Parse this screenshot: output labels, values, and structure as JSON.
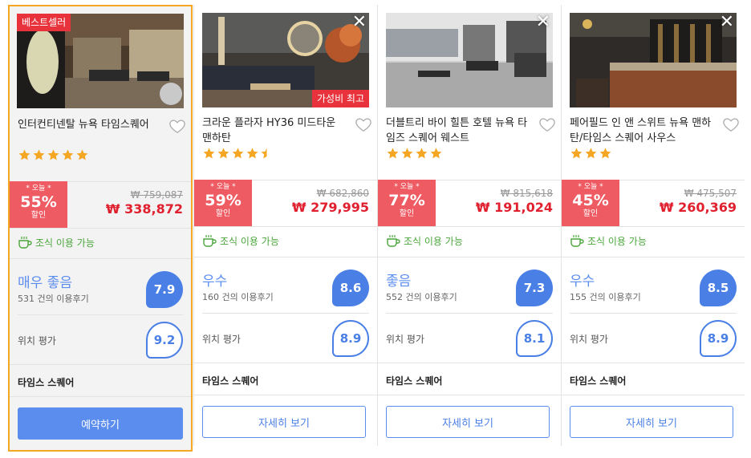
{
  "colors": {
    "accent_blue": "#5b8def",
    "deal_red": "#ef5b62",
    "price_red": "#e0202e",
    "star_orange": "#f5a623",
    "selected_border": "#f5a623",
    "breakfast_green": "#4aa63b"
  },
  "cards": [
    {
      "badge": "베스트셀러",
      "name": "인터컨티넨탈 뉴욕 타임스퀘어",
      "stars": 5,
      "deal_today": "* 오늘 *",
      "deal_pct": "55%",
      "deal_off": "할인",
      "original_price": "₩ 759,087",
      "final_price": "₩ 338,872",
      "breakfast": "조식 이용 가능",
      "rating_word": "매우 좋음",
      "review_count": "531 건의 이용후기",
      "score": "7.9",
      "location_label": "위치 평가",
      "location_score": "9.2",
      "area": "타임스 스퀘어",
      "button": "예약하기"
    },
    {
      "badge": "가성비 최고",
      "name": "크라운 플라자 HY36 미드타운 맨하탄",
      "stars": 4.5,
      "deal_today": "* 오늘 *",
      "deal_pct": "59%",
      "deal_off": "할인",
      "original_price": "₩ 682,860",
      "final_price": "₩ 279,995",
      "breakfast": "조식 이용 가능",
      "rating_word": "우수",
      "review_count": "160 건의 이용후기",
      "score": "8.6",
      "location_label": "위치 평가",
      "location_score": "8.9",
      "area": "타임스 스퀘어",
      "button": "자세히 보기"
    },
    {
      "name": "더블트리 바이 힐튼 호텔 뉴욕 타임즈 스퀘어 웨스트",
      "stars": 4,
      "deal_today": "* 오늘 *",
      "deal_pct": "77%",
      "deal_off": "할인",
      "original_price": "₩ 815,618",
      "final_price": "₩ 191,024",
      "breakfast": "조식 이용 가능",
      "rating_word": "좋음",
      "review_count": "552 건의 이용후기",
      "score": "7.3",
      "location_label": "위치 평가",
      "location_score": "8.1",
      "area": "타임스 스퀘어",
      "button": "자세히 보기"
    },
    {
      "name": "페어필드 인 앤 스위트 뉴욕 맨하탄/타임스 스퀘어 사우스",
      "stars": 3,
      "deal_today": "* 오늘 *",
      "deal_pct": "45%",
      "deal_off": "할인",
      "original_price": "₩ 475,507",
      "final_price": "₩ 260,369",
      "breakfast": "조식 이용 가능",
      "rating_word": "우수",
      "review_count": "155 건의 이용후기",
      "score": "8.5",
      "location_label": "위치 평가",
      "location_score": "8.9",
      "area": "타임스 스퀘어",
      "button": "자세히 보기"
    }
  ],
  "icons": {
    "close": "close-icon",
    "heart": "heart-icon",
    "star": "star-icon",
    "breakfast": "coffee-cup-icon"
  },
  "close_glyph": "✕"
}
